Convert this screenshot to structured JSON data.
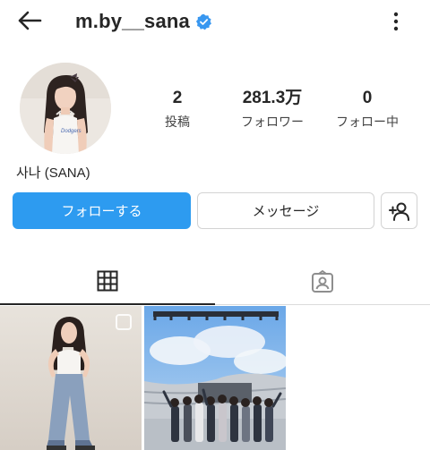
{
  "header": {
    "username": "m.by__sana",
    "back_icon": "arrow-left-icon",
    "verified_icon": "verified-badge-icon",
    "more_icon": "more-vertical-icon"
  },
  "profile": {
    "display_name": "사나 (SANA)",
    "stats": [
      {
        "value": "2",
        "label": "投稿"
      },
      {
        "value": "281.3万",
        "label": "フォロワー"
      },
      {
        "value": "0",
        "label": "フォロー中"
      }
    ]
  },
  "actions": {
    "follow_label": "フォローする",
    "message_label": "メッセージ",
    "add_user_icon": "add-user-icon"
  },
  "tabs": [
    {
      "name": "posts-grid",
      "icon": "grid-icon"
    },
    {
      "name": "tagged",
      "icon": "tagged-person-icon"
    }
  ],
  "colors": {
    "accent": "#2d9bf0",
    "verified": "#3897f0",
    "text": "#262626",
    "border": "#dbdbdb"
  }
}
